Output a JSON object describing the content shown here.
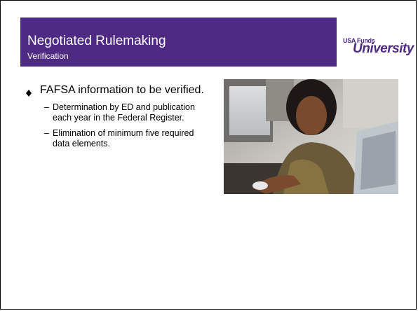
{
  "slide": {
    "title": "Negotiated Rulemaking",
    "subtitle": "Verification"
  },
  "logo": {
    "top_text": "USA Funds",
    "main_text": "University"
  },
  "content": {
    "bullet": "FAFSA information to be verified.",
    "sub_items": [
      "Determination by ED and publication each year in the Federal Register.",
      "Elimination of minimum five required data elements."
    ],
    "dash": "–"
  },
  "colors": {
    "accent": "#4e2a84"
  },
  "icons": {
    "bullet": "diamond-bullet-icon"
  }
}
